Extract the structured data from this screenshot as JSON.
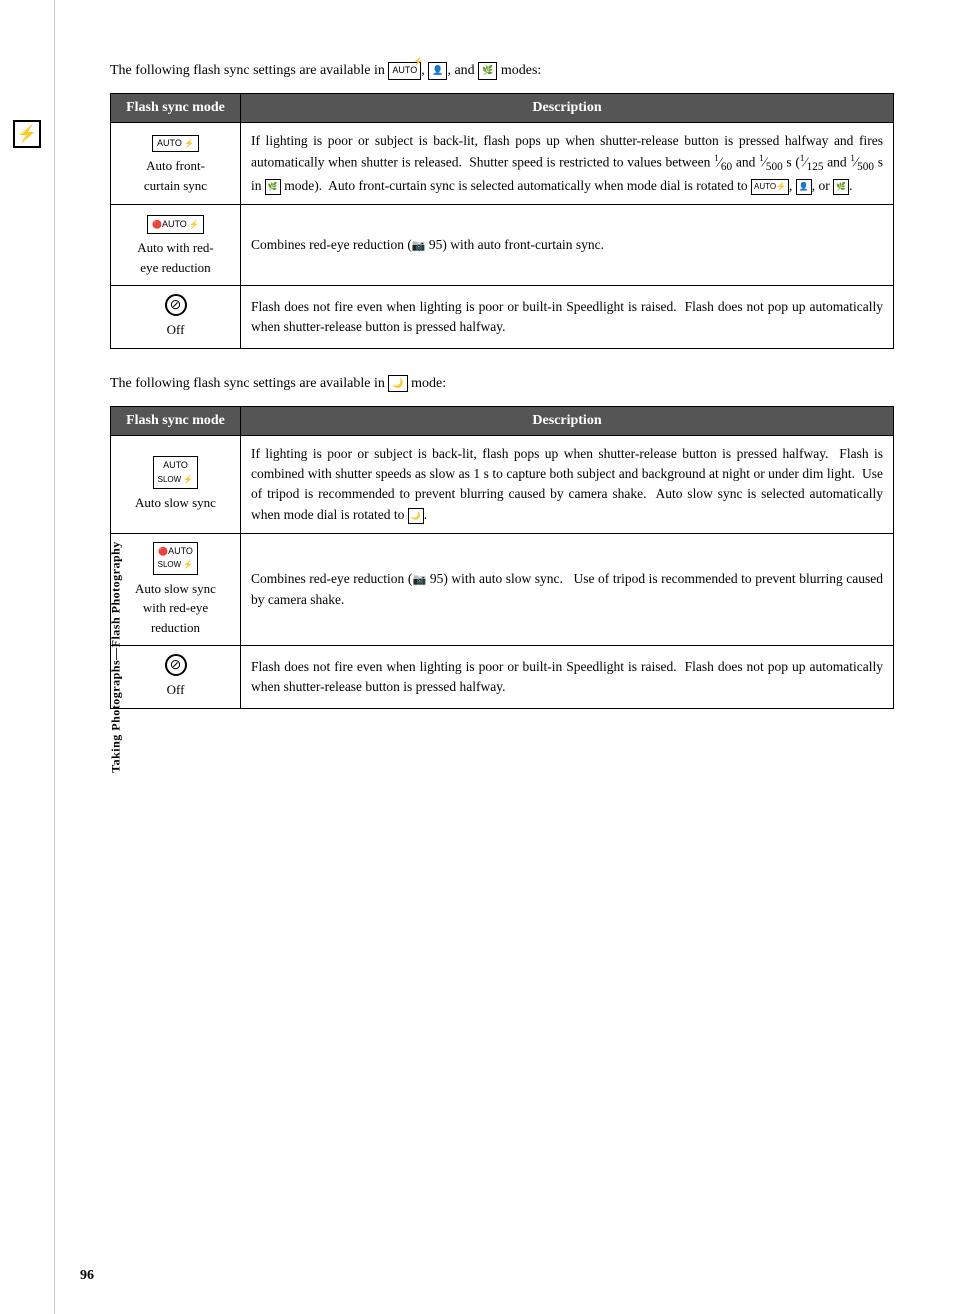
{
  "sidebar": {
    "label": "Taking Photographs—Flash Photography",
    "icon": "⚡"
  },
  "page_number": "96",
  "section1": {
    "intro": "The following flash sync settings are available in",
    "intro_modes": "AUTO, portrait, and scene modes:",
    "table": {
      "col1": "Flash sync mode",
      "col2": "Description",
      "rows": [
        {
          "mode_icon_type": "auto_flash",
          "mode_label": "Auto front-curtain sync",
          "description": "If lighting is poor or subject is back-lit, flash pops up when shutter-release button is pressed halfway and fires automatically when shutter is released.  Shutter speed is restricted to values between ¹⁄₆₀ and ¹⁄₅₀₀ s (¹⁄₁₂₅ and ¹⁄₅₀₀ s in scene mode).  Auto front-curtain sync is selected automatically when mode dial is rotated to AUTO, portrait, or scene."
        },
        {
          "mode_icon_type": "auto_redeye_flash",
          "mode_label": "Auto with red-eye reduction",
          "description": "Combines red-eye reduction (🔴 95) with auto front-curtain sync."
        },
        {
          "mode_icon_type": "off_flash",
          "mode_label": "Off",
          "description": "Flash does not fire even when lighting is poor or built-in Speedlight is raised.  Flash does not pop up automatically when shutter-release button is pressed halfway."
        }
      ]
    }
  },
  "section2": {
    "intro": "The following flash sync settings are available in",
    "intro_modes": "night portrait mode:",
    "table": {
      "col1": "Flash sync mode",
      "col2": "Description",
      "rows": [
        {
          "mode_icon_type": "auto_slow_flash",
          "mode_label": "Auto slow sync",
          "description": "If lighting is poor or subject is back-lit, flash pops up when shutter-release button is pressed halfway.  Flash is combined with shutter speeds as slow as 1 s to capture both subject and background at night or under dim light.  Use of tripod is recommended to prevent blurring caused by camera shake.  Auto slow sync is selected automatically when mode dial is rotated to night portrait."
        },
        {
          "mode_icon_type": "auto_slow_redeye_flash",
          "mode_label": "Auto slow sync with red-eye reduction",
          "description": "Combines red-eye reduction (🔴 95) with auto slow sync.   Use of tripod is recommended to prevent blurring caused by camera shake."
        },
        {
          "mode_icon_type": "off_flash",
          "mode_label": "Off",
          "description": "Flash does not fire even when lighting is poor or built-in Speedlight is raised.  Flash does not pop up automatically when shutter-release button is pressed halfway."
        }
      ]
    }
  }
}
